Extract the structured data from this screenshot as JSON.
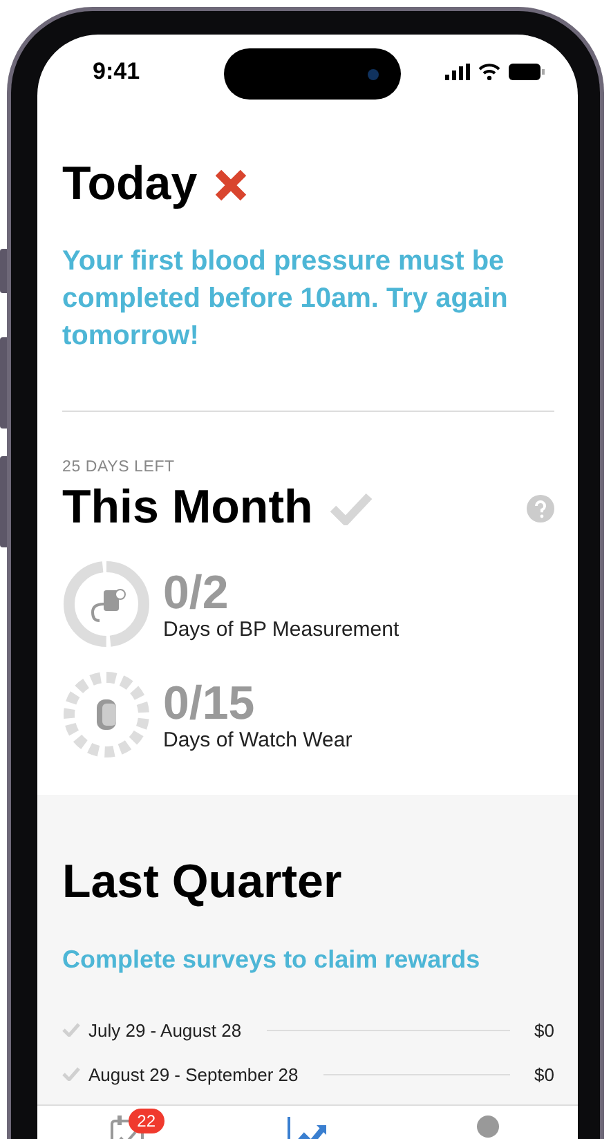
{
  "status_bar": {
    "time": "9:41"
  },
  "today": {
    "title": "Today",
    "failed": true,
    "message": "Your first blood pressure must be completed before 10am. Try again tomorrow!"
  },
  "this_month": {
    "days_left": "25 DAYS LEFT",
    "title": "This Month",
    "complete": false,
    "goals": [
      {
        "kind": "bp",
        "count": "0/2",
        "label": "Days of BP Measurement"
      },
      {
        "kind": "watch",
        "count": "0/15",
        "label": "Days of Watch Wear"
      }
    ]
  },
  "last_quarter": {
    "title": "Last Quarter",
    "link": "Complete surveys to claim rewards",
    "rows": [
      {
        "period": "July 29 - August 28",
        "amount": "$0",
        "checked": false
      },
      {
        "period": "August 29 - September 28",
        "amount": "$0",
        "checked": false
      }
    ]
  },
  "tab_bar": [
    {
      "kind": "tasks",
      "badge": "22",
      "selected": false
    },
    {
      "kind": "progress",
      "selected": true
    },
    {
      "kind": "profile",
      "selected": false
    }
  ]
}
